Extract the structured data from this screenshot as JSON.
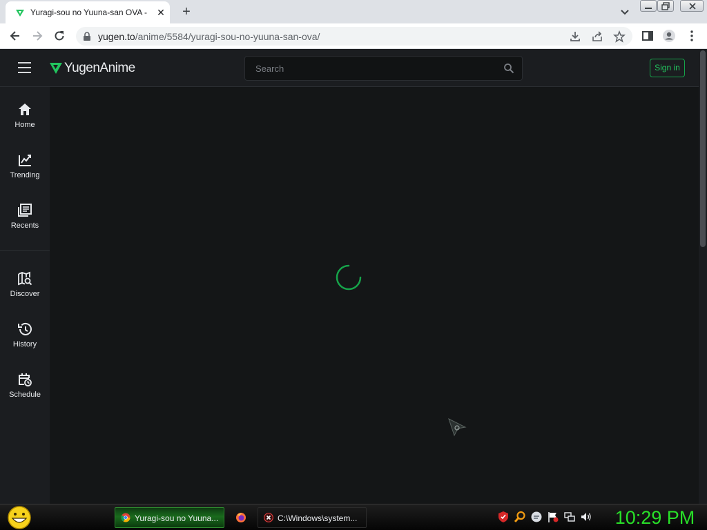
{
  "browser": {
    "tab_title": "Yuragi-sou no Yuuna-san OVA - Y",
    "tab_close": "✕",
    "new_tab": "+",
    "url_host": "yugen.to",
    "url_path": "/anime/5584/yuragi-sou-no-yuuna-san-ova/"
  },
  "site": {
    "logo": "YugenAnime",
    "search_placeholder": "Search",
    "signin_label": "Sign in",
    "accent_color": "#22c55e"
  },
  "sidebar": {
    "items": [
      {
        "label": "Home",
        "icon": "home-icon"
      },
      {
        "label": "Trending",
        "icon": "trending-icon"
      },
      {
        "label": "Recents",
        "icon": "recents-icon"
      },
      {
        "label": "Discover",
        "icon": "discover-icon"
      },
      {
        "label": "History",
        "icon": "history-icon"
      },
      {
        "label": "Schedule",
        "icon": "schedule-icon"
      }
    ]
  },
  "taskbar": {
    "items": [
      {
        "label": "Yuragi-sou no Yuuna...",
        "icon": "chrome-icon"
      },
      {
        "label": "",
        "icon": "firefox-icon"
      },
      {
        "label": "C:\\Windows\\system...",
        "icon": "error-icon"
      }
    ],
    "clock": "10:29 PM",
    "clock_color": "#28e028"
  }
}
